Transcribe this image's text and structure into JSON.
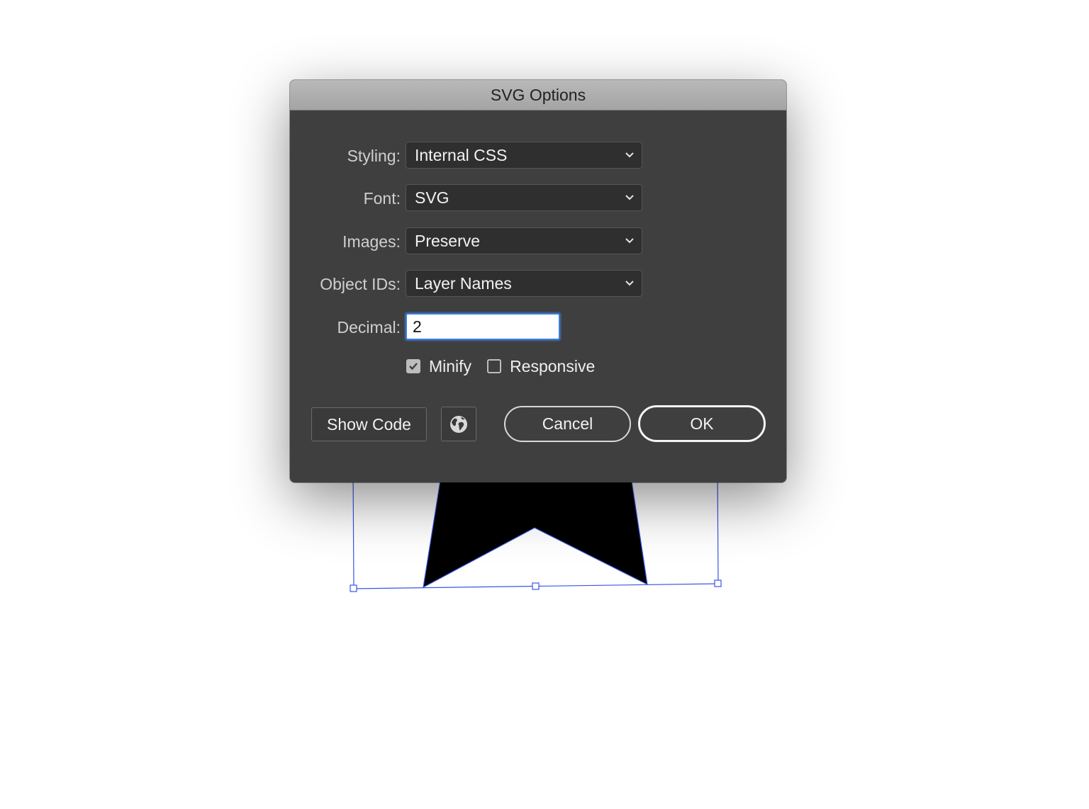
{
  "dialog": {
    "title": "SVG Options",
    "fields": {
      "styling": {
        "label": "Styling:",
        "value": "Internal CSS"
      },
      "font": {
        "label": "Font:",
        "value": "SVG"
      },
      "images": {
        "label": "Images:",
        "value": "Preserve"
      },
      "object_ids": {
        "label": "Object IDs:",
        "value": "Layer Names"
      },
      "decimal": {
        "label": "Decimal:",
        "value": "2"
      }
    },
    "checkboxes": {
      "minify": {
        "label": "Minify",
        "checked": true
      },
      "responsive": {
        "label": "Responsive",
        "checked": false
      }
    },
    "buttons": {
      "show_code": "Show Code",
      "cancel": "Cancel",
      "ok": "OK"
    },
    "icons": {
      "browser": "globe-icon",
      "dropdown": "chevron-down-icon"
    }
  },
  "artboard": {
    "shape": "ribbon-banner",
    "fill": "#000000",
    "selection_color": "#3a55e6"
  }
}
